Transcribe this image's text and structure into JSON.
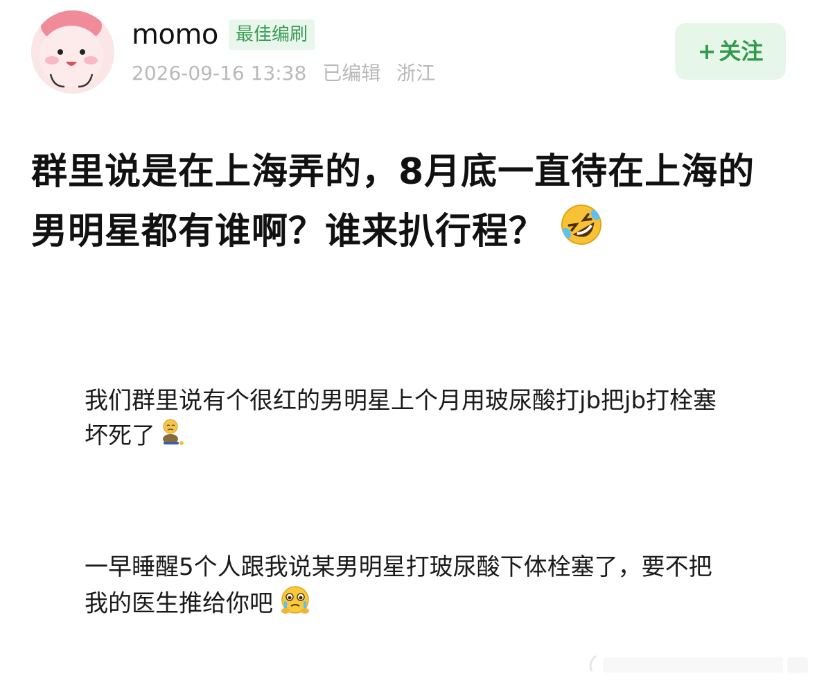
{
  "post": {
    "author": {
      "name": "momo",
      "badge": "最佳编刷"
    },
    "meta": {
      "datetime": "2026-09-16 13:38",
      "edited": "已编辑",
      "location": "浙江"
    },
    "follow_button": {
      "plus": "+",
      "label": "关注"
    },
    "title": "群里说是在上海弄的，8月底一直待在上海的男明星都有谁啊？谁来扒行程？",
    "title_emoji": "rolling-on-floor-laughing-icon"
  },
  "messages": [
    {
      "text": "我们群里说有个很红的男明星上个月用玻尿酸打jb把jb打栓塞坏死了",
      "emoji": "sitting-sad-figure-icon"
    },
    {
      "text": "一早睡醒5个人跟我说某男明星打玻尿酸下体栓塞了，要不把我的医生推给你吧",
      "emoji": "teary-face-icon"
    }
  ],
  "colors": {
    "accent_green": "#2f9a4b",
    "badge_bg": "#e9f6ec",
    "follow_bg": "#e6f6e9",
    "meta_gray": "#b9b9b9",
    "text_dark": "#111111"
  }
}
